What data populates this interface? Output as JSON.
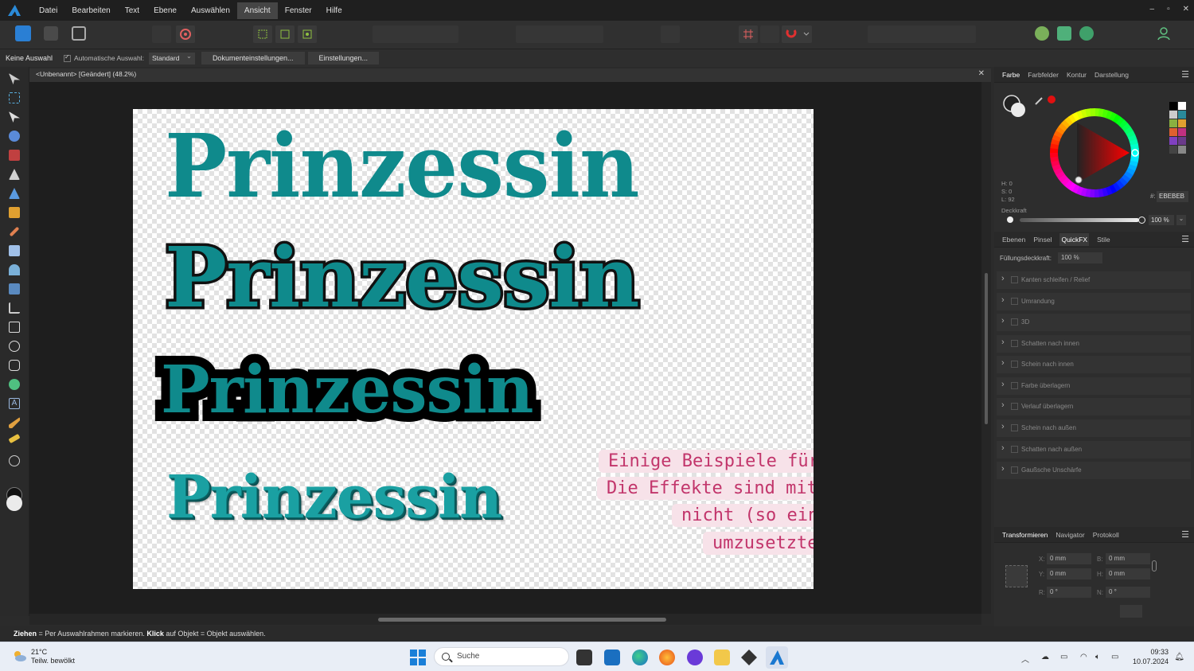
{
  "menu": {
    "items": [
      "Datei",
      "Bearbeiten",
      "Text",
      "Ebene",
      "Auswählen",
      "Ansicht",
      "Fenster",
      "Hilfe"
    ],
    "active": "Ansicht",
    "window_controls": [
      "–",
      "▫",
      "✕"
    ]
  },
  "context": {
    "selection": "Keine Auswahl",
    "auto_select_label": "Automatische Auswahl:",
    "auto_select_value": "Standard",
    "doc_settings": "Dokumenteinstellungen...",
    "settings": "Einstellungen..."
  },
  "document": {
    "tab_title": "<Unbenannt> [Geändert] (48.2%)",
    "close": "✕",
    "words": [
      "Prinzessin",
      "Prinzessin",
      "Prinzessin",
      "Prinzessin"
    ],
    "note_lines": [
      "Einige Beispiele für Grafiktext",
      "Die Effekte sind mit Rahmentext",
      "nicht (so einfach)",
      "umzusetzten"
    ],
    "text_color": "#0f8a8c",
    "note_color": "#c2356b",
    "note_bg": "#f7e2e9"
  },
  "status": {
    "drag_bold": "Ziehen",
    "drag_text": " = Per Auswahlrahmen markieren. ",
    "click_bold": "Klick",
    "click_text": " auf Objekt = Objekt auswählen."
  },
  "color_panel": {
    "tabs": [
      "Farbe",
      "Farbfelder",
      "Kontur",
      "Darstellung"
    ],
    "active_tab": "Farbe",
    "h": "H: 0",
    "s": "S: 0",
    "l": "L: 92",
    "hex_prefix": "#:",
    "hex": "EBEBEB",
    "opacity_label": "Deckkraft",
    "opacity": "100 %"
  },
  "fx_panel": {
    "tabs": [
      "Ebenen",
      "Pinsel",
      "QuickFX",
      "Stile"
    ],
    "active_tab": "QuickFX",
    "fill_opacity_label": "Füllungsdeckkraft:",
    "fill_opacity": "100 %",
    "effects": [
      "Kanten schleifen / Relief",
      "Umrandung",
      "3D",
      "Schatten nach innen",
      "Schein nach innen",
      "Farbe überlagern",
      "Verlauf überlagern",
      "Schein nach außen",
      "Schatten nach außen",
      "Gaußsche Unschärfe"
    ]
  },
  "transform_panel": {
    "tabs": [
      "Transformieren",
      "Navigator",
      "Protokoll"
    ],
    "active_tab": "Transformieren",
    "x_label": "X:",
    "x": "0 mm",
    "y_label": "Y:",
    "y": "0 mm",
    "b_label": "B:",
    "b": "0 mm",
    "h_label": "H:",
    "h": "0 mm",
    "r_label": "R:",
    "r": "0 °",
    "n_label": "N:",
    "n": "0 °"
  },
  "taskbar": {
    "temperature": "21°C",
    "weather": "Teilw. bewölkt",
    "search_placeholder": "Suche",
    "time": "09:33",
    "date": "10.07.2024"
  }
}
